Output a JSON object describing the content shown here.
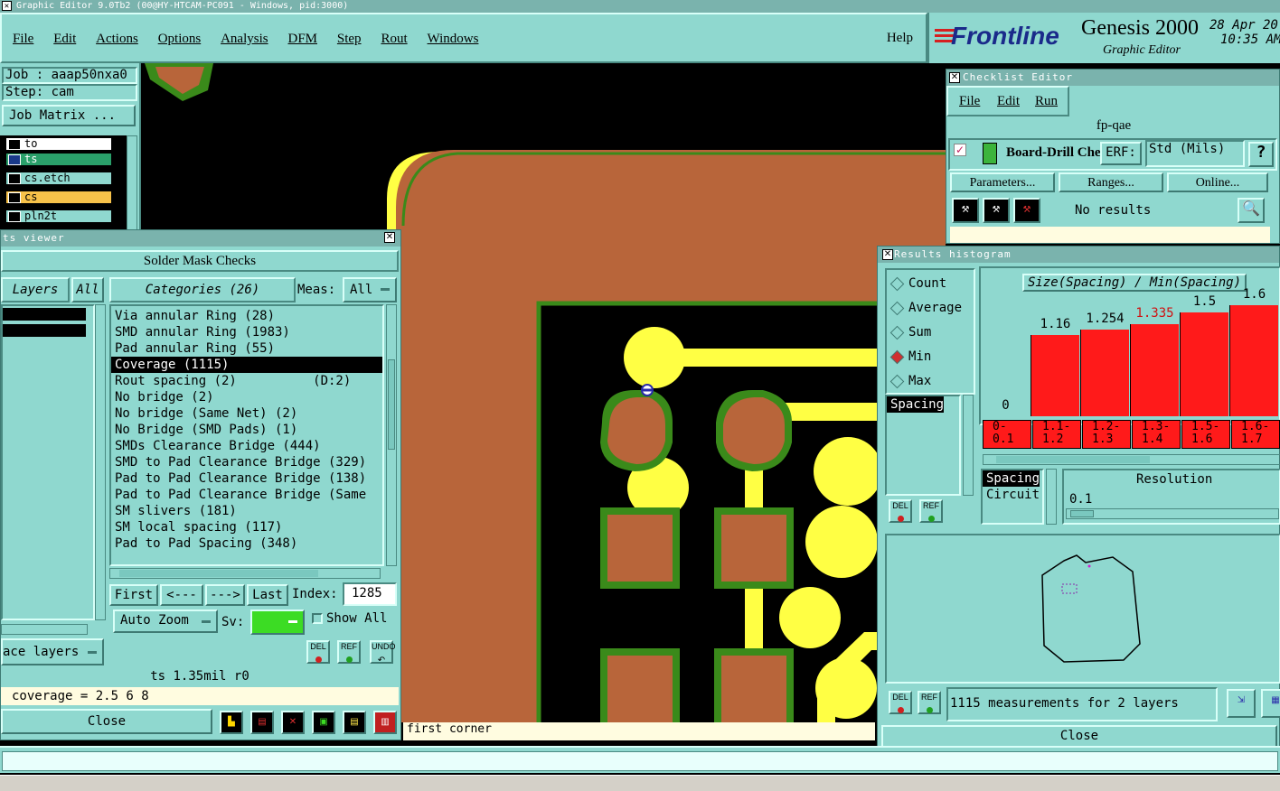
{
  "window_title": "Graphic Editor 9.0Tb2 (00@HY-HTCAM-PC091 - Windows, pid:3000)",
  "menu": [
    "File",
    "Edit",
    "Actions",
    "Options",
    "Analysis",
    "DFM",
    "Step",
    "Rout",
    "Windows"
  ],
  "help": "Help",
  "brand": {
    "logo": "Frontline",
    "product": "Genesis 2000",
    "sub": "Graphic Editor",
    "date": "28 Apr 20",
    "time": "10:35 AM"
  },
  "job": {
    "job": "Job : aaap50nxa0",
    "step": "Step: cam",
    "matrix": "Job Matrix ..."
  },
  "layers": [
    {
      "name": "to",
      "color": "#ffffff"
    },
    {
      "name": "ts",
      "color": "#2aa06a"
    },
    {
      "name": "cs.etch",
      "color": "#ffffff"
    },
    {
      "name": "cs",
      "color": "#f7c24a"
    },
    {
      "name": "pln2t",
      "color": "#ffffff"
    }
  ],
  "results_viewer": {
    "title": "ts viewer",
    "header": "Solder Mask Checks",
    "layers_label": "Layers",
    "all_label": "All",
    "categories_label": "Categories (26)",
    "meas_label": "Meas:",
    "meas_value": "All",
    "categories": [
      "Via annular Ring (28)",
      "SMD annular Ring (1983)",
      "Pad annular Ring (55)",
      "Coverage (1115)",
      "Rout spacing (2)          (D:2)",
      "No bridge (2)",
      "No bridge (Same Net) (2)",
      "No Bridge (SMD Pads) (1)",
      "SMDs Clearance Bridge (444)",
      "SMD to Pad Clearance Bridge (329)",
      "Pad to Pad Clearance Bridge (138)",
      "Pad to Pad Clearance Bridge (Same",
      "SM slivers (181)",
      "SM local spacing (117)",
      "Pad to Pad Spacing (348)"
    ],
    "selected_index": 3,
    "nav": {
      "first": "First",
      "prev": "<---",
      "next": "--->",
      "last": "Last",
      "index_label": "Index:",
      "index_value": "1285"
    },
    "auto_zoom": "Auto Zoom",
    "sv_label": "Sv:",
    "show_all": "Show All",
    "surface_layers": "ace layers",
    "del": "DEL",
    "ref": "REF",
    "undo": "UNDO",
    "status": "ts 1.35mil  r0",
    "coverage_line": "coverage = 2.5 6 8",
    "close": "Close"
  },
  "canvas_prompt": "first corner",
  "checklist": {
    "title": "Checklist Editor",
    "menu": [
      "File",
      "Edit",
      "Run"
    ],
    "name": "fp-qae",
    "item": "Board-Drill Che",
    "erf_label": "ERF:",
    "erf_value": "Std (Mils)",
    "help": "?",
    "parameters": "Parameters...",
    "ranges": "Ranges...",
    "online": "Online...",
    "no_results": "No results"
  },
  "histogram": {
    "title": "Results histogram",
    "modes": [
      "Count",
      "Average",
      "Sum",
      "Min",
      "Max"
    ],
    "selected_mode": "Min",
    "chart_title": "Size(Spacing) / Min(Spacing)",
    "list": [
      "Spacing"
    ],
    "bars": [
      {
        "value": "0",
        "level": 0
      },
      {
        "value": "1.16",
        "level": 0.56
      },
      {
        "value": "1.254",
        "level": 0.6
      },
      {
        "value": "1.335",
        "level": 0.64,
        "highlight": true
      },
      {
        "value": "1.5",
        "level": 0.72
      },
      {
        "value": "1.6",
        "level": 0.77
      }
    ],
    "bins": [
      "0-\n0.1",
      "1.1-\n1.2",
      "1.2-\n1.3",
      "1.3-\n1.4",
      "1.5-\n1.6",
      "1.6-\n1.7"
    ],
    "type_list": [
      "Spacing",
      "Circuit"
    ],
    "resolution_label": "Resolution",
    "resolution_value": "0.1",
    "summary": "1115 measurements for 2 layers",
    "close": "Close",
    "del": "DEL",
    "ref": "REF"
  }
}
